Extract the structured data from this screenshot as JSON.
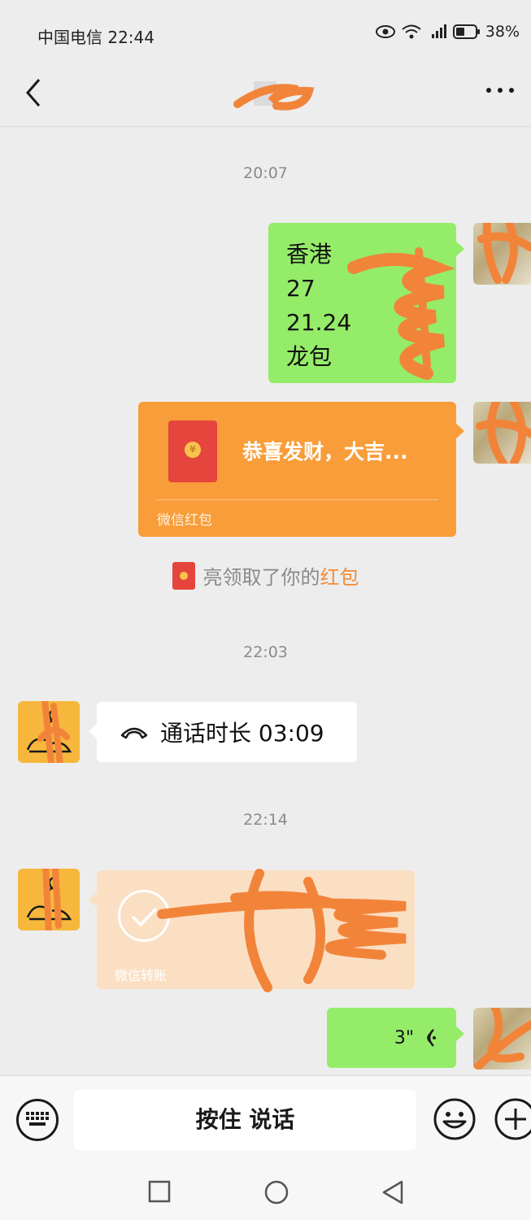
{
  "status_bar": {
    "carrier_time": "中国电信 22:44",
    "battery": "38%"
  },
  "messages": {
    "ts1": "20:07",
    "text_lines": [
      "香港",
      "27",
      "21.24",
      "龙包"
    ],
    "redpacket_title": "恭喜发财，大吉...",
    "redpacket_label": "微信红包",
    "notice_prefix": "亮领取了你的",
    "notice_highlight": "红包",
    "ts2": "22:03",
    "call_text": "通话时长 03:09",
    "ts3": "22:14",
    "transfer_label": "微信转账",
    "voice_duration": "3\""
  },
  "input_bar": {
    "talk_label": "按住 说话"
  },
  "colors": {
    "bubble_green": "#95ec69",
    "redpacket_orange": "#f89d3a",
    "scribble_orange": "#f2843a"
  }
}
